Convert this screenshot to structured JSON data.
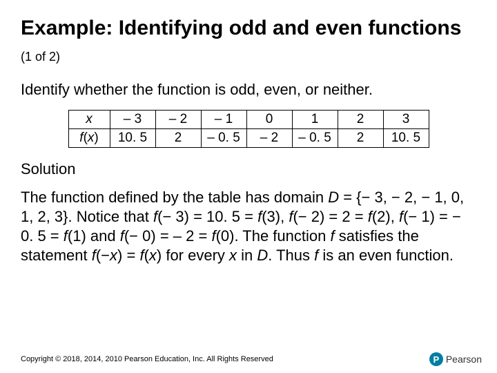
{
  "title": {
    "main": "Example: Identifying odd and even functions",
    "sub": "(1 of 2)"
  },
  "instruction": "Identify whether the function is odd, even, or neither.",
  "table": {
    "row1_label": "x",
    "row2_label_f": "f",
    "row2_label_x": "x",
    "row1": [
      "– 3",
      "– 2",
      "– 1",
      "0",
      "1",
      "2",
      "3"
    ],
    "row2": [
      "10. 5",
      "2",
      "– 0. 5",
      "– 2",
      "– 0. 5",
      "2",
      "10. 5"
    ]
  },
  "solution_heading": "Solution",
  "solution": {
    "p1a": "The function defined by the table has domain ",
    "D": "D",
    "p1b": " = {− 3, − 2, − 1, 0, 1, 2, 3}. Notice that ",
    "f": "f",
    "p1c": "(− 3) = 10. 5 = ",
    "p1d": "(3), ",
    "p1e": "(− 2) = 2 = ",
    "p1f": "(2), ",
    "p1g": "(− 1) = − 0. 5 = ",
    "p1h": "(1) and ",
    "p1i": "(− 0) = – 2 = ",
    "p1j": "(0). The function ",
    "p1k": " satisfies the statement ",
    "p1l": "(−",
    "x": "x",
    "p1m": ") = ",
    "p1n": "(",
    "p1o": ") for every ",
    "p1p": " in ",
    "p1q": ". Thus ",
    "p1r": " is an even function."
  },
  "copyright": "Copyright © 2018, 2014, 2010 Pearson Education, Inc. All Rights Reserved",
  "logo": {
    "badge": "P",
    "text": "Pearson"
  },
  "chart_data": {
    "type": "table",
    "columns": [
      "x",
      "f(x)"
    ],
    "rows": [
      [
        -3,
        10.5
      ],
      [
        -2,
        2
      ],
      [
        -1,
        -0.5
      ],
      [
        0,
        -2
      ],
      [
        1,
        -0.5
      ],
      [
        2,
        2
      ],
      [
        3,
        10.5
      ]
    ]
  }
}
